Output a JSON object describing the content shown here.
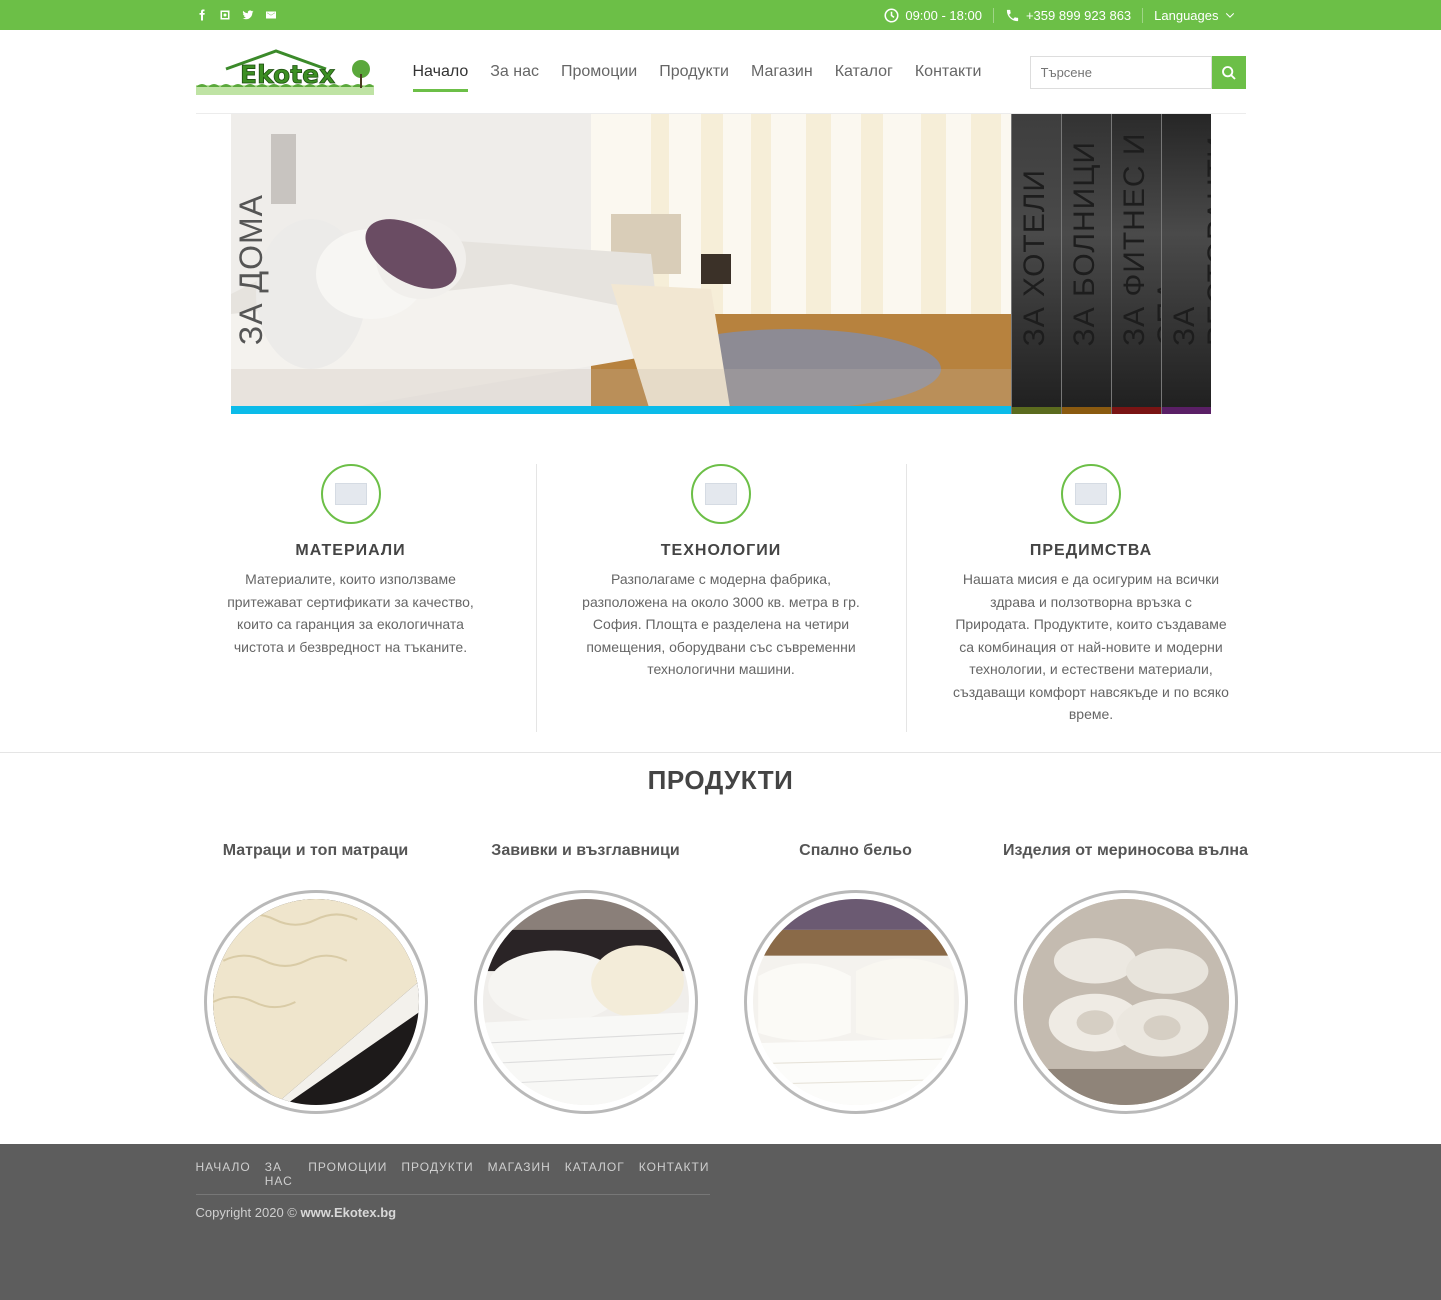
{
  "topbar": {
    "social": [
      "facebook-icon",
      "instagram-icon",
      "twitter-icon",
      "mail-icon"
    ],
    "hours": "09:00 - 18:00",
    "phone": "+359 899 923 863",
    "languages": "Languages"
  },
  "header": {
    "logo_text": "Ekotex",
    "nav": [
      "Начало",
      "За нас",
      "Промоции",
      "Продукти",
      "Магазин",
      "Каталог",
      "Контакти"
    ],
    "active_index": 0,
    "search_placeholder": "Търсене"
  },
  "hero": {
    "main_label": "ЗА ДОМА",
    "tabs": [
      {
        "label": "ЗА ХОТЕЛИ",
        "color": "#5b6b1e"
      },
      {
        "label": "ЗА БОЛНИЦИ",
        "color": "#8a5a10"
      },
      {
        "label": "ЗА ФИТНЕС И СПА",
        "color": "#7a1414"
      },
      {
        "label": "ЗА РЕСТОРАНТИ",
        "color": "#5a1f66"
      }
    ]
  },
  "features": [
    {
      "title": "МАТЕРИАЛИ",
      "text": "Материалите, които използваме притежават сертификати за качество, които са гаранция за екологичната чистота и безвредност на тъканите."
    },
    {
      "title": "ТЕХНОЛОГИИ",
      "text": "Разполагаме с модерна фабрика, разположена на около 3000 кв. метра в гр. София. Площта е разделена на четири помещения, оборудвани със съвременни технологични машини."
    },
    {
      "title": "ПРЕДИМСТВА",
      "text": "Нашата мисия е да осигурим на всички здрава и ползотворна връзка с Природата. Продуктите, които създаваме са комбинация от най-новите и модерни технологии, и естествени материали, създаващи комфорт навсякъде и по всяко време."
    }
  ],
  "products_title": "ПРОДУКТИ",
  "products": [
    {
      "name": "Матраци и топ матраци"
    },
    {
      "name": "Завивки и възглавници"
    },
    {
      "name": "Спално бельо"
    },
    {
      "name": "Изделия от мериносова вълна"
    }
  ],
  "footer": {
    "nav": [
      "НАЧАЛО",
      "ЗА НАС",
      "ПРОМОЦИИ",
      "ПРОДУКТИ",
      "МАГАЗИН",
      "КАТАЛОГ",
      "КОНТАКТИ"
    ],
    "copyright_prefix": "Copyright 2020 © ",
    "copyright_site": "www.Ekotex.bg"
  },
  "colors": {
    "accent": "#6cbf47",
    "hero_bar": "#0bbbe9",
    "footer_bg": "#5d5d5d"
  }
}
